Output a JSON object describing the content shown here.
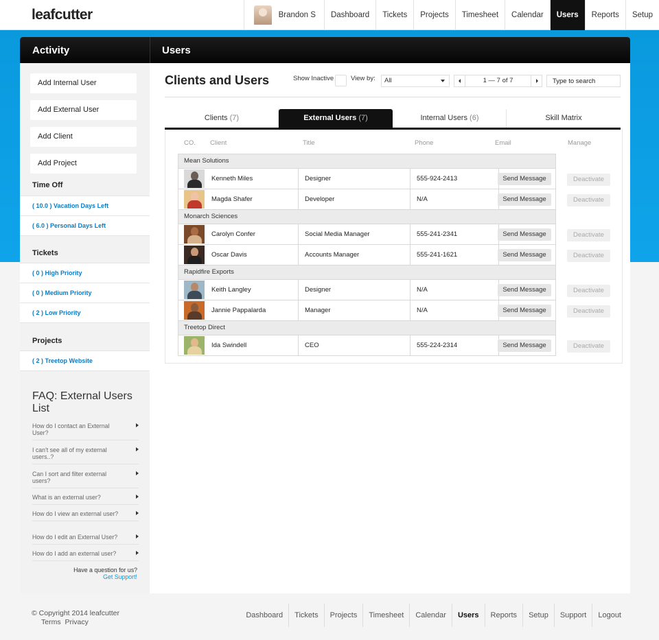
{
  "app": {
    "logo": "leafcutter"
  },
  "topnav": {
    "user_name": "Brandon S",
    "items": [
      "Dashboard",
      "Tickets",
      "Projects",
      "Timesheet",
      "Calendar",
      "Users",
      "Reports",
      "Setup"
    ],
    "active": "Users"
  },
  "panel": {
    "left_title": "Activity",
    "right_title": "Users"
  },
  "sidebar": {
    "actions": [
      "Add Internal User",
      "Add External User",
      "Add Client",
      "Add Project"
    ],
    "time_off": {
      "title": "Time Off",
      "items": [
        {
          "num": "( 10.0 )",
          "label": "Vacation Days Left"
        },
        {
          "num": "( 6.0 )",
          "label": "Personal Days Left"
        }
      ]
    },
    "tickets": {
      "title": "Tickets",
      "items": [
        {
          "num": "( 0 )",
          "label": "High Priority"
        },
        {
          "num": "( 0 )",
          "label": "Medium Priority"
        },
        {
          "num": "( 2 )",
          "label": "Low Priority"
        }
      ]
    },
    "projects": {
      "title": "Projects",
      "items": [
        {
          "num": "( 2 )",
          "label": "Treetop Website"
        }
      ]
    },
    "faq": {
      "title": "FAQ: External Users List",
      "items": [
        "How do I contact an External User?",
        "I can't see all of my external users..?",
        "Can I sort and filter external users?",
        "What is an external user?",
        "How do I view an external user?",
        "How do I edit an External User?",
        "How do I add an external user?"
      ],
      "question": "Have a question for us?",
      "support_link": "Get Support!"
    }
  },
  "content": {
    "title": "Clients and Users",
    "show_inactive_label": "Show Inactive",
    "view_by_label": "View by:",
    "view_by_value": "All",
    "pager_text": "1 — 7 of 7",
    "search_placeholder": "Type to search",
    "tabs": [
      {
        "label": "Clients",
        "count": "(7)"
      },
      {
        "label": "External Users",
        "count": "(7)"
      },
      {
        "label": "Internal Users",
        "count": "(6)"
      },
      {
        "label": "Skill Matrix",
        "count": ""
      }
    ],
    "columns": [
      "CO.",
      "Client",
      "Title",
      "Phone",
      "Email",
      "Manage"
    ],
    "message_label": "Send Message",
    "deactivate_label": "Deactivate",
    "groups": [
      {
        "company": "Mean Solutions",
        "users": [
          {
            "name": "Kenneth Miles",
            "title": "Designer",
            "phone": "555-924-2413"
          },
          {
            "name": "Magda Shafer",
            "title": "Developer",
            "phone": "N/A"
          }
        ]
      },
      {
        "company": "Monarch Sciences",
        "users": [
          {
            "name": "Carolyn Confer",
            "title": "Social Media Manager",
            "phone": "555-241-2341"
          },
          {
            "name": "Oscar Davis",
            "title": "Accounts Manager",
            "phone": "555-241-1621"
          }
        ]
      },
      {
        "company": "Rapidfire Exports",
        "users": [
          {
            "name": "Keith Langley",
            "title": "Designer",
            "phone": "N/A"
          },
          {
            "name": "Jannie Pappalarda",
            "title": "Manager",
            "phone": "N/A"
          }
        ]
      },
      {
        "company": "Treetop Direct",
        "users": [
          {
            "name": "Ida Swindell",
            "title": "CEO",
            "phone": "555-224-2314"
          }
        ]
      }
    ]
  },
  "footer": {
    "copyright": "© Copyright 2014 leafcutter",
    "terms": "Terms",
    "privacy": "Privacy",
    "nav": [
      "Dashboard",
      "Tickets",
      "Projects",
      "Timesheet",
      "Calendar",
      "Users",
      "Reports",
      "Setup",
      "Support",
      "Logout"
    ],
    "active": "Users"
  },
  "colors": {
    "accent_blue": "#0a99dd",
    "link_blue": "#0a7cc4",
    "header_black": "#111111"
  }
}
